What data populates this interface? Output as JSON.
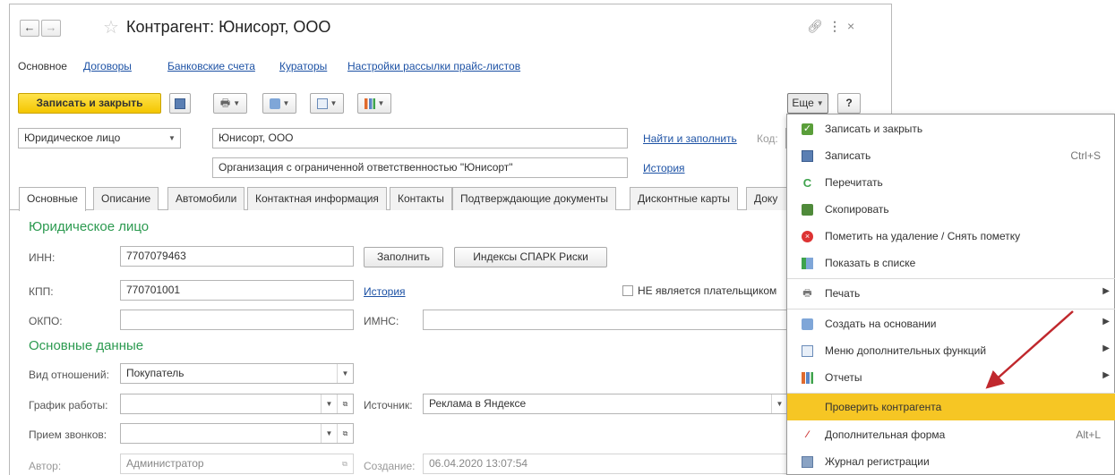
{
  "window": {
    "title": "Контрагент: Юнисорт, ООО",
    "back_icon": "arrow-left-icon",
    "forward_icon": "arrow-right-icon"
  },
  "top_nav": {
    "main": "Основное",
    "links": [
      "Договоры",
      "Банковские счета",
      "Кураторы",
      "Настройки рассылки прайс-листов"
    ]
  },
  "toolbar": {
    "save_close": "Записать и закрыть",
    "more": "Еще",
    "help": "?",
    "accent": "#f4c600"
  },
  "header": {
    "entity_type": "Юридическое лицо",
    "name": "Юнисорт, ООО",
    "find_fill": "Найти и заполнить",
    "code_label": "Код:",
    "full_name": "Организация с ограниченной ответственностью \"Юнисорт\"",
    "history": "История"
  },
  "tabs": [
    "Основные",
    "Описание",
    "Автомобили",
    "Контактная информация",
    "Контакты",
    "Подтверждающие документы",
    "Дисконтные карты",
    "Доку"
  ],
  "legal": {
    "section": "Юридическое лицо",
    "inn_label": "ИНН:",
    "inn": "7707079463",
    "fill_btn": "Заполнить",
    "spark_btn": "Индексы СПАРК Риски",
    "kpp_label": "КПП:",
    "kpp": "770701001",
    "kpp_history": "История",
    "vat_label": "НЕ является плательщиком",
    "okpo_label": "ОКПО:",
    "okpo": "",
    "imns_label": "ИМНС:",
    "imns": ""
  },
  "basic": {
    "section": "Основные данные",
    "relation_label": "Вид отношений:",
    "relation": "Покупатель",
    "schedule_label": "График работы:",
    "schedule": "",
    "source_label": "Источник:",
    "source": "Реклама в Яндексе",
    "calls_label": "Прием звонков:",
    "calls": "",
    "author_label": "Автор:",
    "author": "Администратор",
    "created_label": "Создание:",
    "created": "06.04.2020 13:07:54"
  },
  "menu": {
    "items": [
      {
        "label": "Записать и закрыть",
        "shortcut": "",
        "icon": "check-icon"
      },
      {
        "label": "Записать",
        "shortcut": "Ctrl+S",
        "icon": "floppy-icon"
      },
      {
        "label": "Перечитать",
        "shortcut": "",
        "icon": "refresh-icon"
      },
      {
        "label": "Скопировать",
        "shortcut": "",
        "icon": "copy-icon"
      },
      {
        "label": "Пометить на удаление / Снять пометку",
        "shortcut": "",
        "icon": "delete-mark-icon"
      },
      {
        "label": "Показать в списке",
        "shortcut": "",
        "icon": "list-icon"
      },
      {
        "label": "Печать",
        "shortcut": "",
        "icon": "printer-icon"
      },
      {
        "label": "Создать на основании",
        "shortcut": "",
        "icon": "create-based-icon"
      },
      {
        "label": "Меню дополнительных функций",
        "shortcut": "",
        "icon": "extra-functions-icon"
      },
      {
        "label": "Отчеты",
        "shortcut": "",
        "icon": "reports-icon"
      },
      {
        "label": "Проверить контрагента",
        "shortcut": "",
        "icon": ""
      },
      {
        "label": "Дополнительная форма",
        "shortcut": "Alt+L",
        "icon": "form-icon"
      },
      {
        "label": "Журнал регистрации",
        "shortcut": "",
        "icon": "journal-icon"
      }
    ],
    "highlight_color": "#f6c624",
    "arrow_color": "#c0282d"
  }
}
